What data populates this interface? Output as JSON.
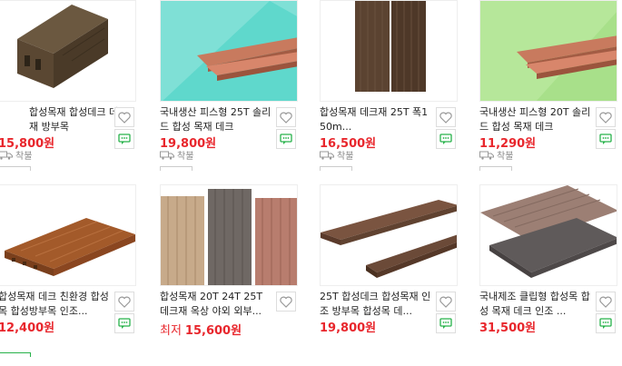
{
  "products": [
    {
      "title": "합성목재 합성데크 데크재 방부목",
      "price": "15,800원",
      "prefix": "",
      "ship": "착불",
      "has_ship": true
    },
    {
      "title": "국내생산 피스형 25T 솔리드 합성 목재 데크",
      "price": "19,800원",
      "prefix": "",
      "ship": "착불",
      "has_ship": true
    },
    {
      "title": "합성목재 데크재 25T 폭150m...",
      "price": "16,500원",
      "prefix": "",
      "ship": "착불",
      "has_ship": true
    },
    {
      "title": "국내생산 피스형 20T 솔리드 합성 목재 데크",
      "price": "11,290원",
      "prefix": "",
      "ship": "착불",
      "has_ship": true
    },
    {
      "title": "합성목재 데크 친환경 합성목 합성방부목 인조...",
      "price": "12,400원",
      "prefix": "",
      "ship": "",
      "has_ship": false
    },
    {
      "title": "합성목재 20T 24T 25T 데크재 옥상 야외 외부...",
      "price": "15,600원",
      "prefix": "최저",
      "ship": "",
      "has_ship": false
    },
    {
      "title": "25T 합성데크 합성목재 인조 방부목 합성목 데...",
      "price": "19,800원",
      "prefix": "",
      "ship": "",
      "has_ship": false
    },
    {
      "title": "국내제조 클립형 합성목 합성 목재 데크 인조 ...",
      "price": "31,500원",
      "prefix": "",
      "ship": "",
      "has_ship": false
    }
  ],
  "icons": {
    "wish": "heart-icon",
    "chat": "chat-icon",
    "ship": "truck-icon"
  },
  "colors": {
    "price": "#e8262c",
    "chat": "#27b24a",
    "heart": "#999999"
  }
}
